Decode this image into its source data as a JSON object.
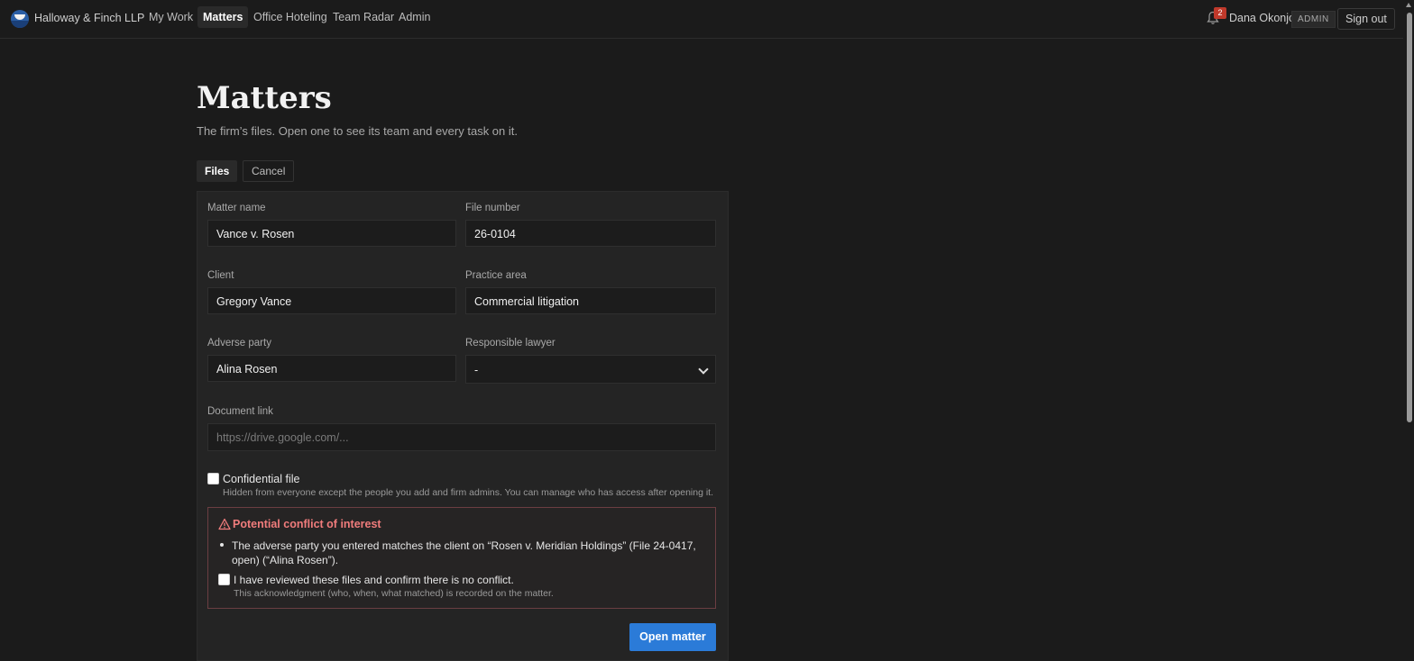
{
  "nav": {
    "brand": "Halloway & Finch LLP",
    "items": [
      {
        "label": "My Work"
      },
      {
        "label": "Matters"
      },
      {
        "label": "Office Hoteling"
      },
      {
        "label": "Team Radar"
      },
      {
        "label": "Admin"
      }
    ],
    "active": "Matters",
    "notification_count": "2",
    "user_name": "Dana Okonjo",
    "role": "ADMIN",
    "sign_out": "Sign out"
  },
  "page": {
    "title": "Matters",
    "subtitle": "The firm’s files. Open one to see its team and every task on it."
  },
  "tabs": {
    "files": "Files",
    "cancel": "Cancel"
  },
  "form": {
    "matter_name": {
      "label": "Matter name",
      "value": "Vance v. Rosen"
    },
    "file_number": {
      "label": "File number",
      "value": "26-0104"
    },
    "client": {
      "label": "Client",
      "value": "Gregory Vance"
    },
    "practice_area": {
      "label": "Practice area",
      "value": "Commercial litigation"
    },
    "adverse_party": {
      "label": "Adverse party",
      "value": "Alina Rosen"
    },
    "responsible_lawyer": {
      "label": "Responsible lawyer",
      "value": "-"
    },
    "document_link": {
      "label": "Document link",
      "placeholder": "https://drive.google.com/..."
    },
    "confidential": {
      "label": "Confidential file",
      "hint": "Hidden from everyone except the people you add and firm admins. You can manage who has access after opening it.",
      "checked": false
    },
    "conflict": {
      "title": "Potential conflict of interest",
      "message": "The adverse party you entered matches the client on “Rosen v. Meridian Holdings” (File 24-0417, open) (“Alina Rosen”).",
      "ack_label": "I have reviewed these files and confirm there is no conflict.",
      "ack_hint": "This acknowledgment (who, when, what matched) is recorded on the matter.",
      "ack_checked": false
    },
    "submit": "Open matter"
  },
  "colors": {
    "accent": "#2b7bd8",
    "warning": "#f07c7c",
    "badge": "#c0392b"
  }
}
